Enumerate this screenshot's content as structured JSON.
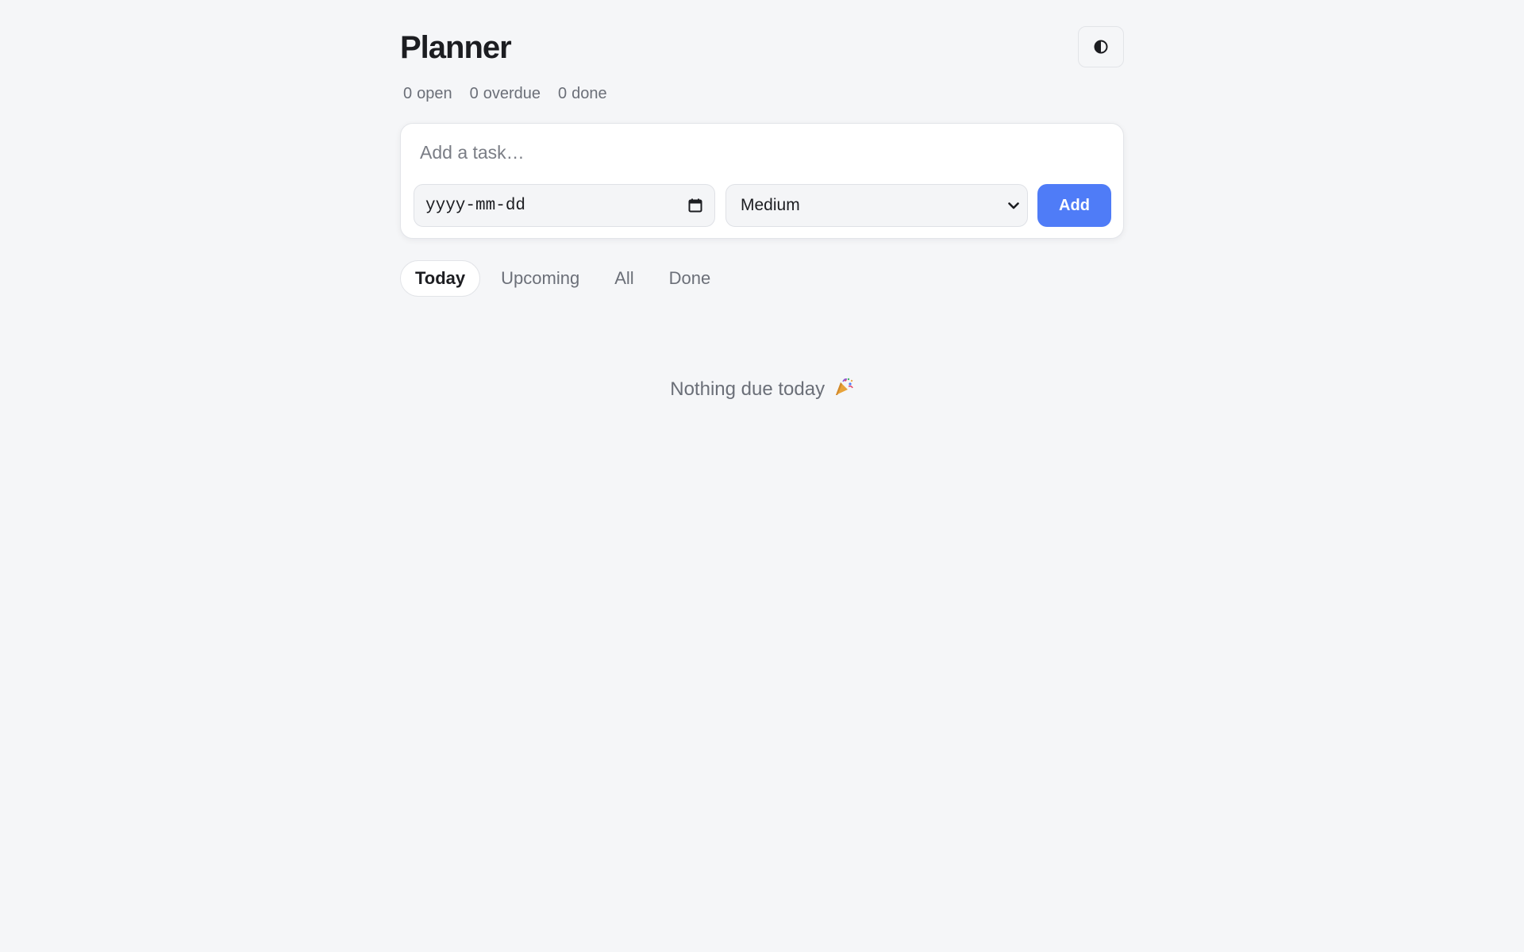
{
  "header": {
    "title": "Planner",
    "theme_toggle_icon": "contrast-icon"
  },
  "stats": [
    {
      "count": "0",
      "label": "open"
    },
    {
      "count": "0",
      "label": "overdue"
    },
    {
      "count": "0",
      "label": "done"
    }
  ],
  "composer": {
    "task_placeholder": "Add a task…",
    "task_value": "",
    "date_placeholder": "yyyy-mm-dd",
    "priority_selected": "Medium",
    "add_label": "Add"
  },
  "tabs": [
    {
      "label": "Today",
      "active": true
    },
    {
      "label": "Upcoming",
      "active": false
    },
    {
      "label": "All",
      "active": false
    },
    {
      "label": "Done",
      "active": false
    }
  ],
  "empty_state": {
    "message": "Nothing due today",
    "emoji_icon": "party-popper-icon"
  },
  "colors": {
    "background": "#f5f6f8",
    "accent": "#4f7cf7",
    "muted_text": "#6b6f78",
    "text": "#1c1d21"
  }
}
